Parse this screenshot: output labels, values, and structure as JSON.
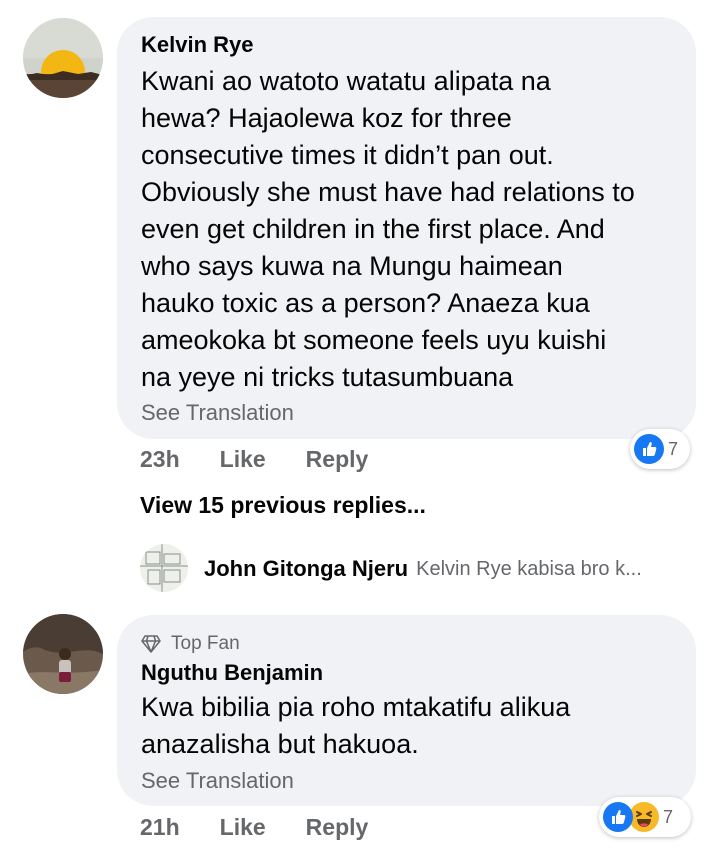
{
  "comments": [
    {
      "author": "Kelvin Rye",
      "text": "Kwani ao watoto watatu alipata na\nhewa? Hajaolewa koz for three\nconsecutive times it didn’t pan out.\nObviously she must have had relations to\neven get children in the first place. And\nwho says kuwa na Mungu haimean\nhauko toxic as a person? Anaeza kua\nameokoka bt someone feels uyu kuishi\nna yeye ni tricks tutasumbuana",
      "see_translation": "See Translation",
      "time": "23h",
      "like_label": "Like",
      "reply_label": "Reply",
      "reactions": [
        "like-reaction"
      ],
      "reaction_count": "7"
    },
    {
      "badge": "Top Fan",
      "author": "Nguthu Benjamin",
      "text": "Kwa bibilia pia roho mtakatifu alikua\nanazalisha but hakuoa.",
      "see_translation": "See Translation",
      "time": "21h",
      "like_label": "Like",
      "reply_label": "Reply",
      "reactions": [
        "like-reaction",
        "haha-reaction"
      ],
      "reaction_count": "7"
    }
  ],
  "view_replies": "View 15 previous replies...",
  "latest_reply": {
    "author": "John Gitonga Njeru",
    "snippet": "Kelvin Rye kabisa bro k..."
  },
  "colors": {
    "bubble": "#f0f2f5",
    "secondary_text": "#65676b",
    "like_blue": "#1877f2",
    "haha_yellow": "#f7b928"
  }
}
